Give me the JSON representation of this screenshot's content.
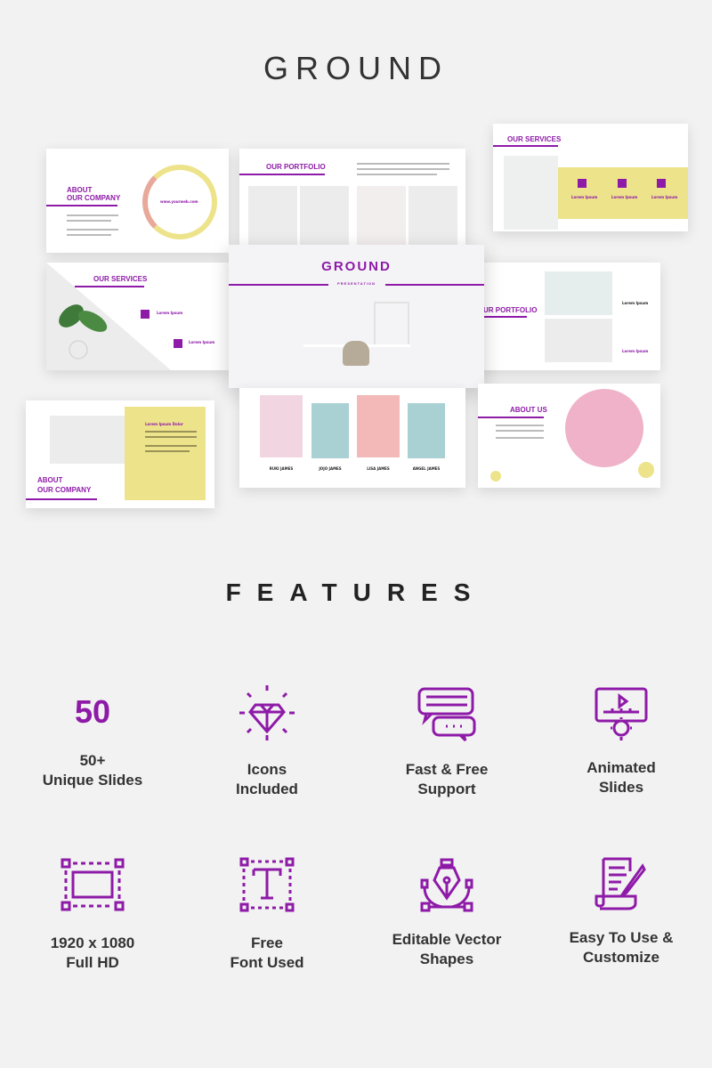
{
  "title": "GROUND",
  "slides": {
    "about_company": {
      "heading_1": "ABOUT",
      "heading_2": "OUR COMPANY",
      "url": "www.yourweb.com"
    },
    "portfolio": {
      "heading": "OUR PORTFOLIO"
    },
    "services_top": {
      "heading": "OUR SERVICES",
      "items": [
        "Lorem Ipsum",
        "Lorem Ipsum",
        "Lorem Ipsum"
      ]
    },
    "services_left": {
      "heading": "OUR SERVICES",
      "items": [
        "Lorem Ipsum",
        "Lorem Ipsum"
      ]
    },
    "cover": {
      "heading": "GROUND",
      "subtitle": "PRESENTATION"
    },
    "portfolio_right": {
      "heading": "UR PORTFOLIO",
      "items": [
        "Lorem Ipsum",
        "Lorem Ipsum"
      ]
    },
    "about_company_2": {
      "heading_1": "ABOUT",
      "heading_2": "OUR COMPANY",
      "subheading": "Lorem Ipsum Dolor"
    },
    "team": {
      "members": [
        "RUKI JAMES",
        "JOJO JAMES",
        "LISA JAMES",
        "ANGEL JAMES"
      ]
    },
    "about_us": {
      "heading": "ABOUT US"
    }
  },
  "features_title": "FEATURES",
  "features": [
    {
      "icon": "number-50",
      "big": "50",
      "line1": "50+",
      "line2": "Unique Slides"
    },
    {
      "icon": "diamond-icon",
      "line1": "Icons",
      "line2": "Included"
    },
    {
      "icon": "chat-bubbles-icon",
      "line1": "Fast & Free",
      "line2": "Support"
    },
    {
      "icon": "animated-monitor-icon",
      "line1": "Animated",
      "line2": "Slides"
    },
    {
      "icon": "frame-icon",
      "line1": "1920 x 1080",
      "line2": "Full HD"
    },
    {
      "icon": "font-icon",
      "line1": "Free",
      "line2": "Font Used"
    },
    {
      "icon": "pen-tool-icon",
      "line1": "Editable Vector",
      "line2": "Shapes"
    },
    {
      "icon": "document-edit-icon",
      "line1": "Easy To Use &",
      "line2": "Customize"
    }
  ],
  "colors": {
    "accent": "#8e1aa8",
    "yellow": "#ede38a",
    "background": "#f2f2f2"
  }
}
